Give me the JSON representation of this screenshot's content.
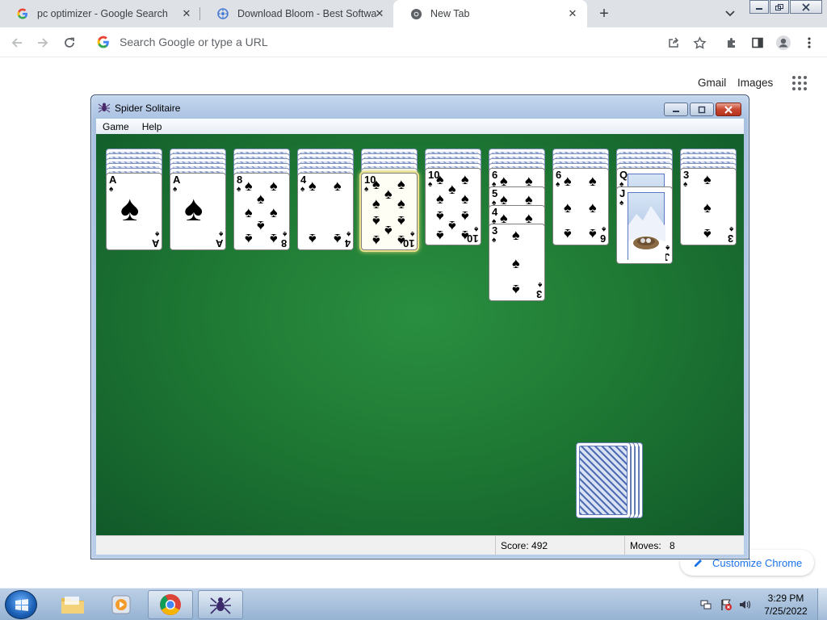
{
  "browser": {
    "tabs": [
      {
        "title": "pc optimizer - Google Search",
        "favicon": "google-g-icon",
        "active": false
      },
      {
        "title": "Download Bloom - Best Software",
        "favicon": "bloom-icon",
        "active": false
      },
      {
        "title": "New Tab",
        "favicon": "chrome-icon",
        "active": true
      }
    ],
    "omnibox_placeholder": "Search Google or type a URL"
  },
  "ntp": {
    "links": [
      "Gmail",
      "Images"
    ],
    "customize_label": "Customize Chrome"
  },
  "solitaire": {
    "title": "Spider Solitaire",
    "menu": [
      "Game",
      "Help"
    ],
    "score_label": "Score: 492",
    "moves_label": "Moves:",
    "moves_value": "8",
    "columns": [
      {
        "hidden": 5,
        "face_up": [
          "A"
        ]
      },
      {
        "hidden": 5,
        "face_up": [
          "A"
        ]
      },
      {
        "hidden": 5,
        "face_up": [
          "8"
        ]
      },
      {
        "hidden": 5,
        "face_up": [
          "4"
        ]
      },
      {
        "hidden": 5,
        "face_up": [
          "10"
        ],
        "selected": true
      },
      {
        "hidden": 4,
        "face_up": [
          "10"
        ]
      },
      {
        "hidden": 4,
        "face_up": [
          "6",
          "5",
          "4",
          "3"
        ]
      },
      {
        "hidden": 4,
        "face_up": [
          "6"
        ]
      },
      {
        "hidden": 4,
        "face_up": [
          "Q",
          "J"
        ]
      },
      {
        "hidden": 4,
        "face_up": [
          "3"
        ]
      }
    ],
    "stock_piles": 4
  },
  "taskbar": {
    "clock_time": "3:29 PM",
    "clock_date": "7/25/2022"
  }
}
